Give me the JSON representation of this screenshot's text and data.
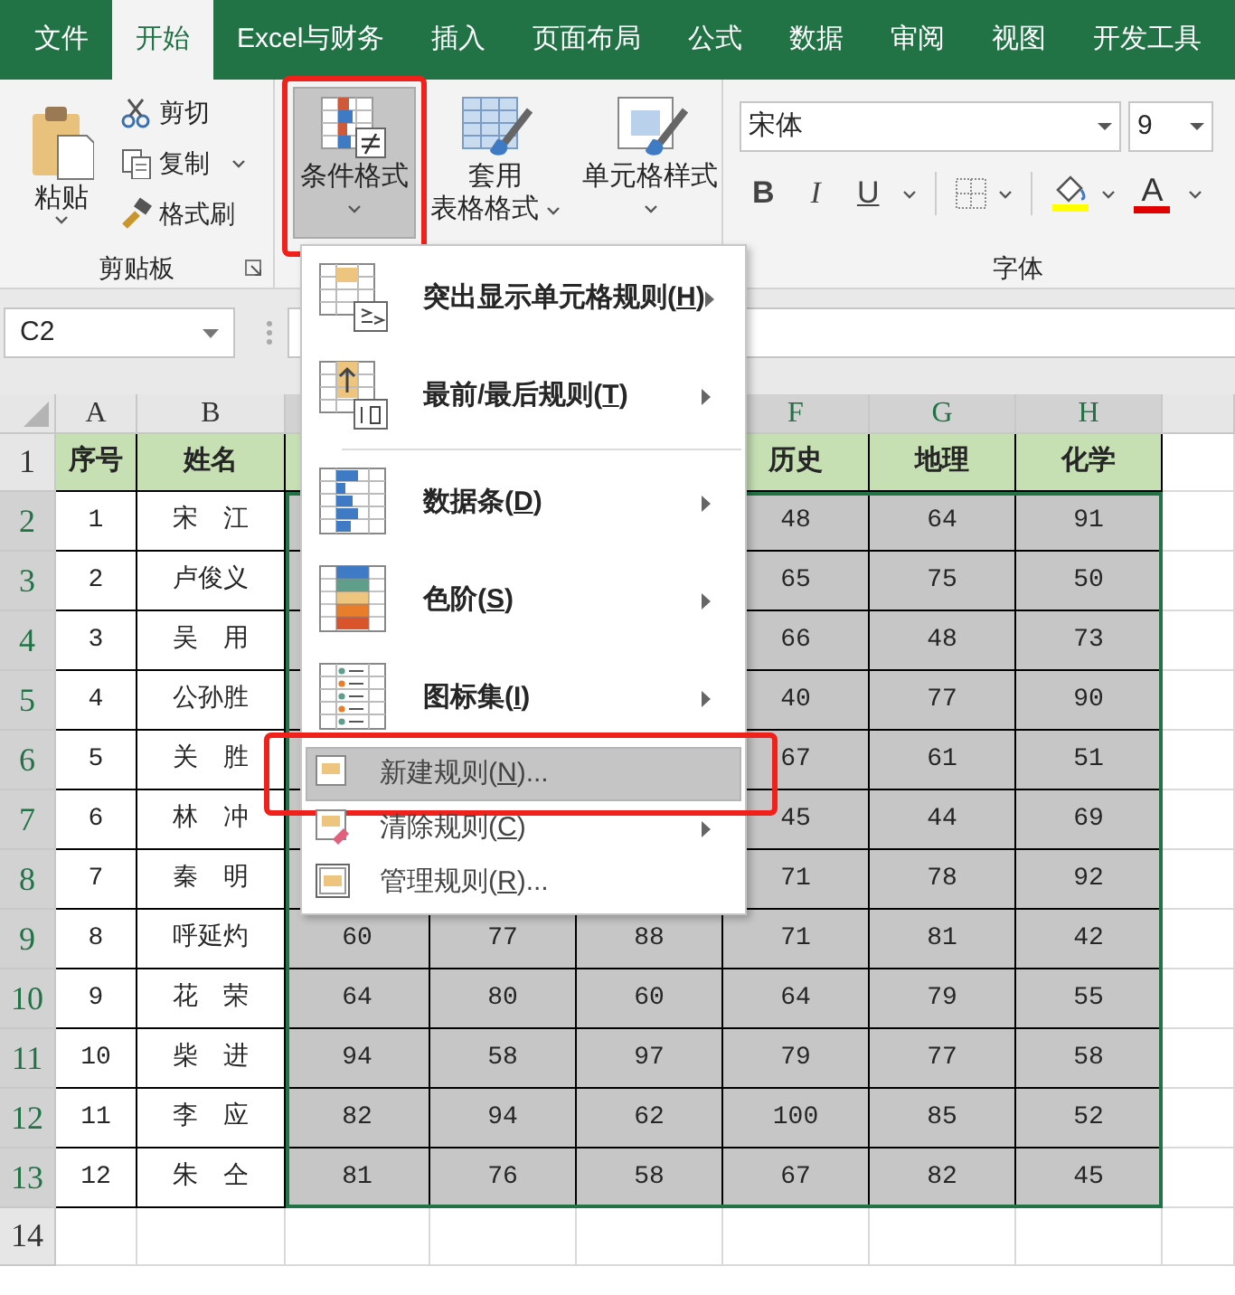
{
  "tabs": [
    {
      "label": "文件",
      "selected": false
    },
    {
      "label": "开始",
      "selected": true
    },
    {
      "label": "Excel与财务",
      "selected": false
    },
    {
      "label": "插入",
      "selected": false
    },
    {
      "label": "页面布局",
      "selected": false
    },
    {
      "label": "公式",
      "selected": false
    },
    {
      "label": "数据",
      "selected": false
    },
    {
      "label": "审阅",
      "selected": false
    },
    {
      "label": "视图",
      "selected": false
    },
    {
      "label": "开发工具",
      "selected": false
    }
  ],
  "clipboard": {
    "paste": "粘贴",
    "actions": [
      {
        "label": "剪切",
        "dropdown": false
      },
      {
        "label": "复制",
        "dropdown": true
      },
      {
        "label": "格式刷",
        "dropdown": false
      }
    ],
    "group_label": "剪贴板"
  },
  "styles": {
    "buttons": [
      {
        "lines": [
          "条件格式"
        ],
        "pressed": true,
        "circled": true
      },
      {
        "lines": [
          "套用",
          "表格格式"
        ],
        "pressed": false,
        "circled": false
      },
      {
        "lines": [
          "单元格样式"
        ],
        "pressed": false,
        "circled": false
      }
    ]
  },
  "font": {
    "name": "宋体",
    "size": "9",
    "format_buttons": [
      "B",
      "I",
      "U"
    ],
    "font_color_glyph": "A",
    "group_label": "字体"
  },
  "name_box": "C2",
  "sheet": {
    "columns": [
      {
        "letter": "A",
        "selected": false
      },
      {
        "letter": "B",
        "selected": false
      },
      {
        "selected": true
      },
      {
        "selected": true
      },
      {
        "selected": true
      },
      {
        "letter": "F",
        "selected": true
      },
      {
        "letter": "G",
        "selected": true
      },
      {
        "letter": "H",
        "selected": true
      }
    ],
    "rows": [
      {
        "number": "1",
        "selected": false,
        "cells": [
          "序号",
          "姓名",
          null,
          null,
          null,
          "历史",
          "地理",
          "化学"
        ]
      },
      {
        "number": "2",
        "selected": true,
        "cells": [
          "1",
          "宋　江",
          null,
          null,
          null,
          "48",
          "64",
          "91"
        ]
      },
      {
        "number": "3",
        "selected": true,
        "cells": [
          "2",
          "卢俊义",
          null,
          null,
          null,
          "65",
          "75",
          "50"
        ]
      },
      {
        "number": "4",
        "selected": true,
        "cells": [
          "3",
          "吴　用",
          null,
          null,
          null,
          "66",
          "48",
          "73"
        ]
      },
      {
        "number": "5",
        "selected": true,
        "cells": [
          "4",
          "公孙胜",
          null,
          null,
          null,
          "40",
          "77",
          "90"
        ]
      },
      {
        "number": "6",
        "selected": true,
        "cells": [
          "5",
          "关　胜",
          null,
          null,
          null,
          "67",
          "61",
          "51"
        ]
      },
      {
        "number": "7",
        "selected": true,
        "cells": [
          "6",
          "林　冲",
          null,
          null,
          null,
          "45",
          "44",
          "69"
        ]
      },
      {
        "number": "8",
        "selected": true,
        "cells": [
          "7",
          "秦　明",
          null,
          null,
          null,
          "71",
          "78",
          "92"
        ]
      },
      {
        "number": "9",
        "selected": true,
        "cells": [
          "8",
          "呼延灼",
          "60",
          "77",
          "88",
          "71",
          "81",
          "42"
        ]
      },
      {
        "number": "10",
        "selected": true,
        "cells": [
          "9",
          "花　荣",
          "64",
          "80",
          "60",
          "64",
          "79",
          "55"
        ]
      },
      {
        "number": "11",
        "selected": true,
        "cells": [
          "10",
          "柴　进",
          "94",
          "58",
          "97",
          "79",
          "77",
          "58"
        ]
      },
      {
        "number": "12",
        "selected": true,
        "cells": [
          "11",
          "李　应",
          "82",
          "94",
          "62",
          "100",
          "85",
          "52"
        ]
      },
      {
        "number": "13",
        "selected": true,
        "cells": [
          "12",
          "朱　仝",
          "81",
          "76",
          "58",
          "67",
          "82",
          "45"
        ]
      },
      {
        "number": "14",
        "selected": false,
        "cells": [
          null,
          null,
          null,
          null,
          null,
          null,
          null,
          null
        ]
      }
    ]
  },
  "menu": {
    "items": [
      {
        "kind": "large",
        "label_before": "突出显示单元格规则(",
        "access_key": "H",
        "label_after": ")",
        "submenu": true,
        "selected": false,
        "circled": false
      },
      {
        "kind": "large",
        "label_before": "最前/最后规则(",
        "access_key": "T",
        "label_after": ")",
        "submenu": true,
        "selected": false,
        "circled": false
      },
      {
        "kind": "separator"
      },
      {
        "kind": "large",
        "label_before": "数据条(",
        "access_key": "D",
        "label_after": ")",
        "submenu": true,
        "selected": false,
        "circled": false
      },
      {
        "kind": "large",
        "label_before": "色阶(",
        "access_key": "S",
        "label_after": ")",
        "submenu": true,
        "selected": false,
        "circled": false
      },
      {
        "kind": "large",
        "label_before": "图标集(",
        "access_key": "I",
        "label_after": ")",
        "submenu": true,
        "selected": false,
        "circled": false
      },
      {
        "kind": "small",
        "label_before": "新建规则(",
        "access_key": "N",
        "label_after": ")...",
        "submenu": false,
        "selected": true,
        "circled": true
      },
      {
        "kind": "small",
        "label_before": "清除规则(",
        "access_key": "C",
        "label_after": ")",
        "submenu": true,
        "selected": false,
        "circled": false
      },
      {
        "kind": "small",
        "label_before": "管理规则(",
        "access_key": "R",
        "label_after": ")...",
        "submenu": false,
        "selected": false,
        "circled": false
      }
    ]
  }
}
